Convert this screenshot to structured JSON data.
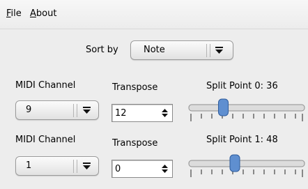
{
  "menu": {
    "file": "File",
    "about": "About"
  },
  "sort": {
    "label": "Sort by",
    "value": "Note"
  },
  "rows": [
    {
      "midi_label": "MIDI Channel",
      "midi_value": "9",
      "transpose_label": "Transpose",
      "transpose_value": "12",
      "split_label": "Split Point  0:",
      "split_value": "36",
      "split_fraction": 0.31
    },
    {
      "midi_label": "MIDI Channel",
      "midi_value": "1",
      "transpose_label": "Transpose",
      "transpose_value": "0",
      "split_label": "Split Point  1:",
      "split_value": "48",
      "split_fraction": 0.42
    }
  ],
  "icons": {
    "dropdown": "dropdown-arrow-icon",
    "spinner": "spin-updown-icon",
    "slider": "slider-handle"
  }
}
